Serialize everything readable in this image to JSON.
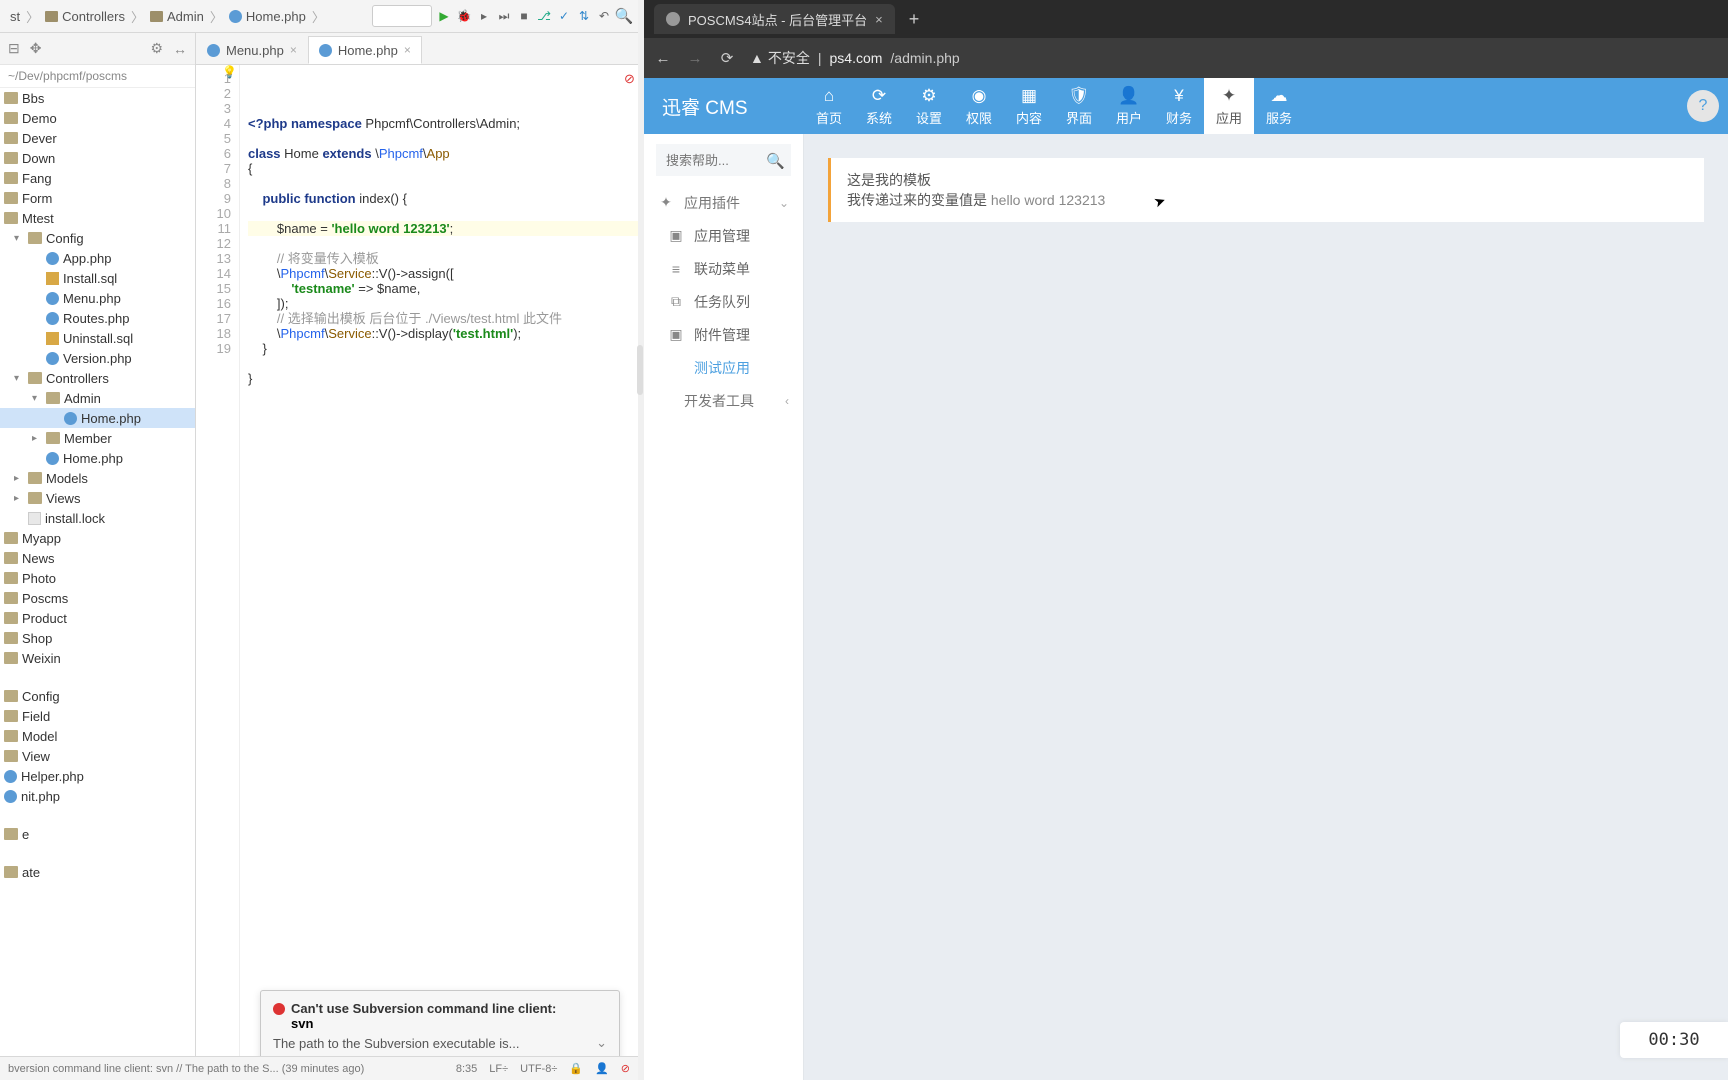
{
  "breadcrumb": {
    "items": [
      "st",
      "Controllers",
      "Admin",
      "Home.php"
    ]
  },
  "toolbar_icons": [
    "run",
    "bug",
    "cov",
    "stop",
    "stop2",
    "git",
    "branch",
    "diff",
    "undo",
    "search"
  ],
  "ptree": {
    "hdr_icons": [
      "⊟",
      "✥",
      "⚙",
      "↔"
    ],
    "path": "~/Dev/phpcmf/poscms",
    "nodes": [
      {
        "t": "Bbs",
        "k": "fold",
        "ind": 0
      },
      {
        "t": "Demo",
        "k": "fold",
        "ind": 0
      },
      {
        "t": "Dever",
        "k": "fold",
        "ind": 0
      },
      {
        "t": "Down",
        "k": "fold",
        "ind": 0
      },
      {
        "t": "Fang",
        "k": "fold",
        "ind": 0
      },
      {
        "t": "Form",
        "k": "fold",
        "ind": 0
      },
      {
        "t": "Mtest",
        "k": "fold",
        "ind": 0,
        "open": true
      },
      {
        "t": "Config",
        "k": "fold",
        "ind": 1,
        "open": true
      },
      {
        "t": "App.php",
        "k": "php",
        "ind": 2
      },
      {
        "t": "Install.sql",
        "k": "sql",
        "ind": 2
      },
      {
        "t": "Menu.php",
        "k": "php",
        "ind": 2
      },
      {
        "t": "Routes.php",
        "k": "php",
        "ind": 2
      },
      {
        "t": "Uninstall.sql",
        "k": "sql",
        "ind": 2
      },
      {
        "t": "Version.php",
        "k": "php",
        "ind": 2
      },
      {
        "t": "Controllers",
        "k": "fold",
        "ind": 1,
        "open": true
      },
      {
        "t": "Admin",
        "k": "fold",
        "ind": 2,
        "open": true
      },
      {
        "t": "Home.php",
        "k": "php",
        "ind": 3,
        "sel": true
      },
      {
        "t": "Member",
        "k": "fold",
        "ind": 2
      },
      {
        "t": "Home.php",
        "k": "php",
        "ind": 2
      },
      {
        "t": "Models",
        "k": "fold",
        "ind": 1
      },
      {
        "t": "Views",
        "k": "fold",
        "ind": 1
      },
      {
        "t": "install.lock",
        "k": "file",
        "ind": 1
      },
      {
        "t": "Myapp",
        "k": "fold",
        "ind": 0
      },
      {
        "t": "News",
        "k": "fold",
        "ind": 0
      },
      {
        "t": "Photo",
        "k": "fold",
        "ind": 0
      },
      {
        "t": "Poscms",
        "k": "fold",
        "ind": 0
      },
      {
        "t": "Product",
        "k": "fold",
        "ind": 0
      },
      {
        "t": "Shop",
        "k": "fold",
        "ind": 0
      },
      {
        "t": "Weixin",
        "k": "fold",
        "ind": 0
      },
      {
        "t": "",
        "k": "gap",
        "ind": 0
      },
      {
        "t": "Config",
        "k": "fold",
        "ind": 0
      },
      {
        "t": "Field",
        "k": "fold",
        "ind": 0
      },
      {
        "t": "Model",
        "k": "fold",
        "ind": 0
      },
      {
        "t": "View",
        "k": "fold",
        "ind": 0
      },
      {
        "t": "Helper.php",
        "k": "php",
        "ind": 0
      },
      {
        "t": "nit.php",
        "k": "php",
        "ind": 0
      },
      {
        "t": "",
        "k": "gap",
        "ind": 0
      },
      {
        "t": "e",
        "k": "fold",
        "ind": 0
      },
      {
        "t": "",
        "k": "gap",
        "ind": 0
      },
      {
        "t": "ate",
        "k": "fold",
        "ind": 0
      }
    ]
  },
  "tabs": [
    {
      "name": "Menu.php",
      "active": false
    },
    {
      "name": "Home.php",
      "active": true
    }
  ],
  "code": {
    "count": 19,
    "lines": [
      {
        "n": 1,
        "html": "<span class='kw'>&lt;?php</span> <span class='kw'>namespace</span> Phpcmf\\Controllers\\Admin;"
      },
      {
        "n": 2,
        "html": ""
      },
      {
        "n": 3,
        "html": "<span class='kw'>class</span> Home <span class='kw'>extends</span> \\<span class='cls'>Phpcmf</span>\\<span class='spec'>App</span>"
      },
      {
        "n": 4,
        "html": "{"
      },
      {
        "n": 5,
        "html": ""
      },
      {
        "n": 6,
        "html": "    <span class='kw'>public function</span> <span class='fn'>index</span>() {"
      },
      {
        "n": 7,
        "html": ""
      },
      {
        "n": 8,
        "hl": true,
        "bulb": true,
        "html": "        $name = <span class='str'>'hello word 123213'</span>;"
      },
      {
        "n": 9,
        "html": ""
      },
      {
        "n": 10,
        "html": "        <span class='cmt'>// 将变量传入模板</span>"
      },
      {
        "n": 11,
        "html": "        \\<span class='cls'>Phpcmf</span>\\<span class='spec'>Service</span>::V()-&gt;assign(["
      },
      {
        "n": 12,
        "html": "            <span class='str'>'testname'</span> =&gt; $name,"
      },
      {
        "n": 13,
        "html": "        ]);"
      },
      {
        "n": 14,
        "html": "        <span class='cmt'>// 选择输出模板 后台位于 ./Views/test.html 此文件</span>"
      },
      {
        "n": 15,
        "html": "        \\<span class='cls'>Phpcmf</span>\\<span class='spec'>Service</span>::V()-&gt;display(<span class='str'>'test.html'</span>);"
      },
      {
        "n": 16,
        "html": "    }"
      },
      {
        "n": 17,
        "html": ""
      },
      {
        "n": 18,
        "html": "}"
      },
      {
        "n": 19,
        "html": ""
      }
    ]
  },
  "svn": {
    "title": "Can't use Subversion command line client:",
    "sub": "svn",
    "detail": "The path to the Subversion executable is..."
  },
  "status": {
    "left": "bversion command line client: svn // The path to the S... (39 minutes ago)",
    "pos": "8:35",
    "le": "LF÷",
    "enc": "UTF-8÷"
  },
  "browser": {
    "tab_title": "POSCMS4站点 - 后台管理平台",
    "security": "不安全",
    "url_host": "ps4.com",
    "url_path": "/admin.php"
  },
  "cms": {
    "brand": "迅睿 CMS",
    "menu": [
      {
        "ico": "⌂",
        "t": "首页"
      },
      {
        "ico": "⟳",
        "t": "系统"
      },
      {
        "ico": "⚙",
        "t": "设置"
      },
      {
        "ico": "◉",
        "t": "权限"
      },
      {
        "ico": "▦",
        "t": "内容"
      },
      {
        "ico": "🛡",
        "t": "界面"
      },
      {
        "ico": "👤",
        "t": "用户"
      },
      {
        "ico": "¥",
        "t": "财务"
      },
      {
        "ico": "✦",
        "t": "应用",
        "active": true
      },
      {
        "ico": "☁",
        "t": "服务"
      }
    ],
    "search_ph": "搜索帮助...",
    "side": [
      {
        "ico": "✦",
        "t": "应用插件",
        "hdr": true,
        "caret": "⌄"
      },
      {
        "ico": "▣",
        "t": "应用管理",
        "sub": true
      },
      {
        "ico": "≡",
        "t": "联动菜单",
        "sub": true
      },
      {
        "ico": "⧉",
        "t": "任务队列",
        "sub": true
      },
      {
        "ico": "▣",
        "t": "附件管理",
        "sub": true
      },
      {
        "ico": "</> ",
        "t": "测试应用",
        "sub": true,
        "active": true
      },
      {
        "ico": "</> ",
        "t": "开发者工具",
        "hdr": true,
        "caret": "‹"
      }
    ],
    "card": {
      "l1": "这是我的模板",
      "l2_label": "我传递过来的变量值是 ",
      "l2_value": "hello word 123213"
    }
  },
  "timer": "00:30"
}
